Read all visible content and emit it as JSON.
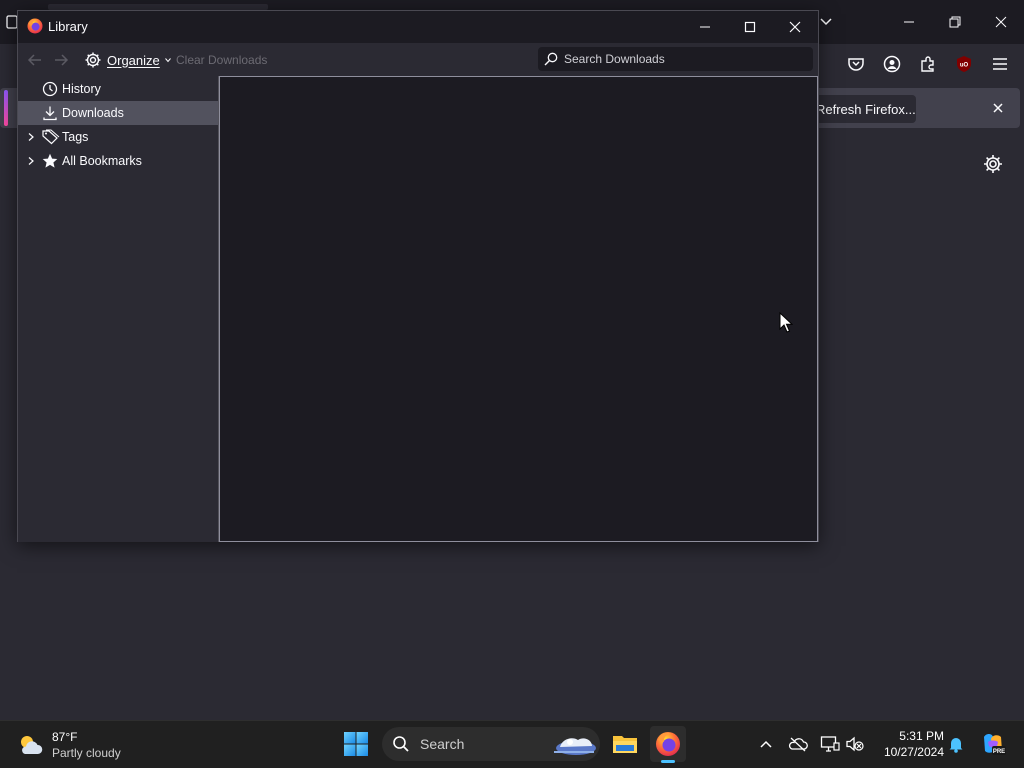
{
  "background_window": {
    "notification": {
      "button_label": "Refresh Firefox..."
    },
    "toolbar_icons": [
      "pocket-icon",
      "account-icon",
      "extensions-icon",
      "ublock-icon",
      "menu-icon"
    ]
  },
  "library": {
    "title": "Library",
    "toolbar": {
      "organize_label": "Organize",
      "clear_label": "Clear Downloads",
      "search_placeholder": "Search Downloads"
    },
    "sidebar": {
      "items": [
        {
          "label": "History",
          "icon": "clock-icon",
          "expandable": false,
          "selected": false
        },
        {
          "label": "Downloads",
          "icon": "download-icon",
          "expandable": false,
          "selected": true
        },
        {
          "label": "Tags",
          "icon": "tag-icon",
          "expandable": true,
          "selected": false
        },
        {
          "label": "All Bookmarks",
          "icon": "star-icon",
          "expandable": true,
          "selected": false
        }
      ]
    }
  },
  "taskbar": {
    "weather": {
      "temp": "87°F",
      "desc": "Partly cloudy"
    },
    "search_label": "Search",
    "clock": {
      "time": "5:31 PM",
      "date": "10/27/2024"
    }
  },
  "colors": {
    "accent": "#4cc2ff",
    "window_bg": "#2b2a33",
    "panel_bg": "#1c1b22"
  }
}
